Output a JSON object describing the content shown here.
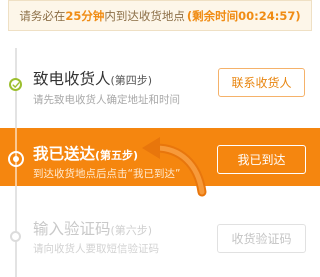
{
  "notice": {
    "prefix": "请务必在",
    "deadline": "25分钟",
    "suffix": "内到达收货地点",
    "remaining": "(剩余时间00:24:57)"
  },
  "steps": [
    {
      "title": "致电收货人",
      "step": "(第四步)",
      "desc": "请先致电收货人确定地址和时间",
      "button": "联系收货人",
      "status": "done"
    },
    {
      "title": "我已送达",
      "step": "(第五步)",
      "desc": "到达收货地点后点击“我已到达”",
      "button": "我已到达",
      "status": "active"
    },
    {
      "title": "输入验证码",
      "step": "(第六步)",
      "desc": "请向收货人要取短信验证码",
      "button": "收货验证码",
      "status": "pending"
    }
  ],
  "colors": {
    "accent": "#f5860f",
    "done": "#9cbf2f",
    "notice_bg": "#fdf6e9"
  },
  "icons": {
    "done": "check-circle-icon",
    "active": "radio-dot-icon",
    "pending": "empty-circle-icon",
    "hint": "curved-arrow-icon"
  }
}
